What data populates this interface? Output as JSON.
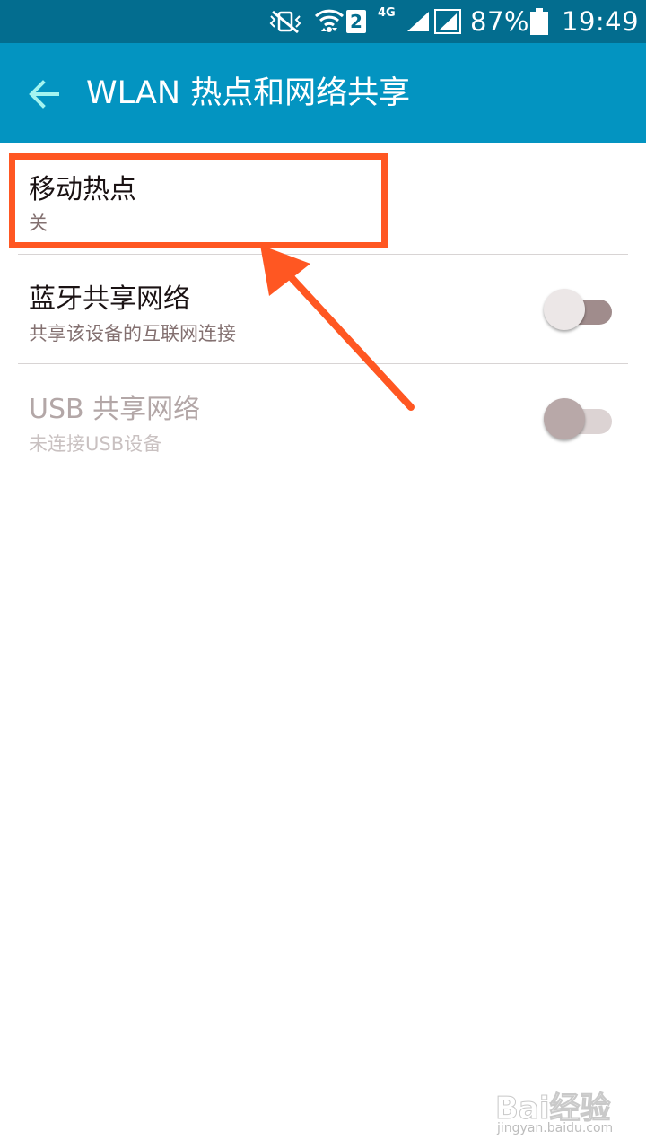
{
  "status_bar": {
    "sim_slot": "2",
    "network_type": "4G",
    "battery_percent": "87%",
    "time": "19:49",
    "icons": [
      "vibrate-mute-icon",
      "wifi-icon",
      "sim-2-icon",
      "signal-icon",
      "signal-icon",
      "battery-icon"
    ]
  },
  "app_bar": {
    "title": "WLAN 热点和网络共享",
    "back_icon": "back-arrow-icon"
  },
  "settings": [
    {
      "title": "移动热点",
      "subtitle": "关",
      "has_toggle": false,
      "enabled": true
    },
    {
      "title": "蓝牙共享网络",
      "subtitle": "共享该设备的互联网连接",
      "has_toggle": true,
      "toggle_on": false,
      "enabled": true
    },
    {
      "title": "USB 共享网络",
      "subtitle": "未连接USB设备",
      "has_toggle": true,
      "toggle_on": false,
      "enabled": false
    }
  ],
  "annotation": {
    "color": "#ff5722"
  },
  "watermark": {
    "brand": "Bai经验",
    "url": "jingyan.baidu.com"
  },
  "colors": {
    "status_bar": "#036d8f",
    "app_bar": "#0394c1",
    "back_arrow": "#a4f4f0",
    "toggle_track_off": "#a08c8c",
    "toggle_thumb_off": "#ece7e7"
  }
}
